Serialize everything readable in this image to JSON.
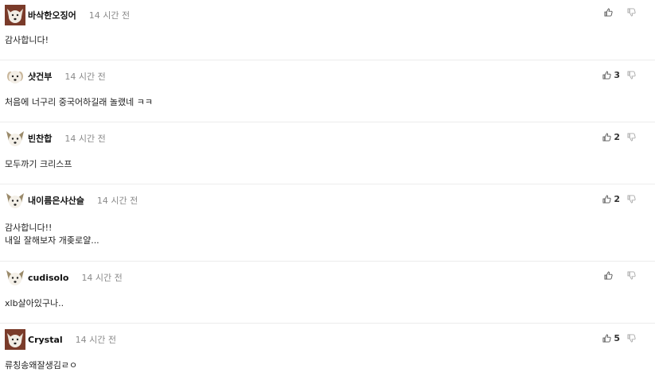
{
  "comments": [
    {
      "nickname": "바삭한오징어",
      "time": "14 시간 전",
      "body": [
        "감사합니다!"
      ],
      "likes": "",
      "avatar": "dog-avatar-icon"
    },
    {
      "nickname": "샷건부",
      "time": "14 시간 전",
      "body": [
        "처음에 너구리 중국어하길래 놀랬네 ㅋㅋ"
      ],
      "likes": "3",
      "avatar": "dog-avatar-icon"
    },
    {
      "nickname": "빈찬합",
      "time": "14 시간 전",
      "body": [
        "모두까기 크리스프"
      ],
      "likes": "2",
      "avatar": "dog-avatar-icon"
    },
    {
      "nickname": "내이름은샤산슬",
      "time": "14 시간 전",
      "body": [
        "감사합니다!!",
        "내일 잘해보자 개좆로얄..."
      ],
      "likes": "2",
      "avatar": "dog-avatar-icon"
    },
    {
      "nickname": "cudisolo",
      "time": "14 시간 전",
      "body": [
        "xlb살아있구나.."
      ],
      "likes": "",
      "avatar": "dog-avatar-icon"
    },
    {
      "nickname": "Crystal",
      "time": "14 시간 전",
      "body": [
        "류칭송왜잘생김ㄹㅇ"
      ],
      "likes": "5",
      "avatar": "dog-avatar-icon"
    }
  ],
  "icons": {
    "like": "thumbs-up-icon",
    "dislike": "thumbs-down-icon"
  },
  "colors": {
    "divider": "#ececec",
    "time": "#8a8a8a",
    "icon": "#555555"
  }
}
